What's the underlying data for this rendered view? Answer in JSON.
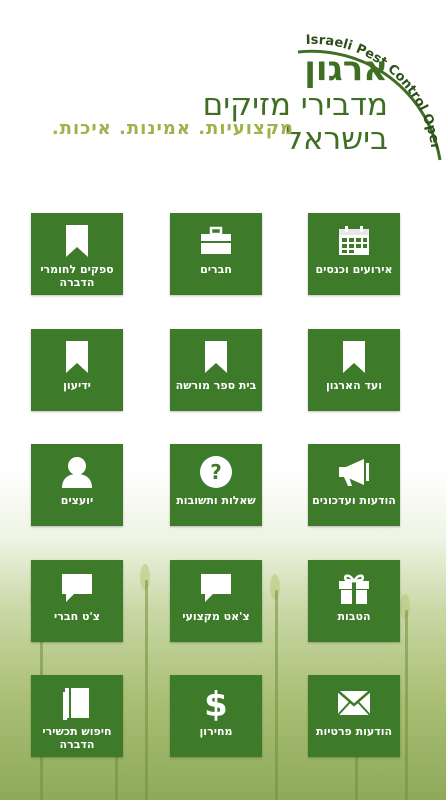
{
  "header": {
    "logo_line1": "ארגון",
    "logo_line2": "מדבירי מזיקים",
    "logo_line3": "בישראל",
    "slogan": "מקצועיות. אמינות. איכות.",
    "arc_text": "Israeli Pest Control Operators Association"
  },
  "tiles": [
    {
      "label": "אירועים וכנסים",
      "icon": "calendar-icon"
    },
    {
      "label": "חברים",
      "icon": "briefcase-icon"
    },
    {
      "label": "ספקים לחומרי הדברה",
      "icon": "bookmark-icon"
    },
    {
      "label": "ועד הארגון",
      "icon": "bookmark-icon"
    },
    {
      "label": "בית ספר מורשה",
      "icon": "bookmark-icon"
    },
    {
      "label": "ידיעון",
      "icon": "bookmark-icon"
    },
    {
      "label": "הודעות ועדכונים",
      "icon": "megaphone-icon"
    },
    {
      "label": "שאלות ותשובות",
      "icon": "question-icon"
    },
    {
      "label": "יועצים",
      "icon": "user-icon"
    },
    {
      "label": "הטבות",
      "icon": "gift-icon"
    },
    {
      "label": "צ'אט מקצועי",
      "icon": "chat-icon"
    },
    {
      "label": "צ'ט חברי",
      "icon": "chat-icon"
    },
    {
      "label": "הודעות פרטיות",
      "icon": "envelope-icon"
    },
    {
      "label": "מחירון",
      "icon": "dollar-icon"
    },
    {
      "label": "חיפוש תכשירי הדברה",
      "icon": "book-icon"
    }
  ],
  "colors": {
    "tile": "#3d7a2a",
    "logo": "#3f6f23",
    "slogan": "#9db34b"
  }
}
